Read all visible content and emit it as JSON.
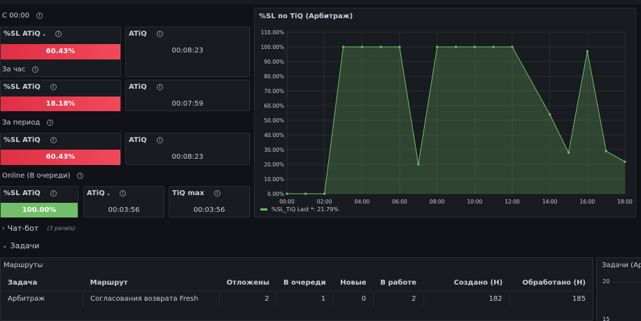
{
  "section_today": {
    "label": "С 00:00"
  },
  "section_hour": {
    "label": "За час"
  },
  "section_period": {
    "label": "За период"
  },
  "section_online": {
    "label": "Online (В очереди)"
  },
  "stats_today": {
    "sl_title": "%SL ATiQ .",
    "sl_value": "60.43%",
    "atiq_title": "ATiQ",
    "atiq_value": "00:08:23"
  },
  "stats_hour": {
    "sl_title": "%SL ATiQ",
    "sl_value": "18.18%",
    "atiq_title": "ATiQ",
    "atiq_value": "00:07:59"
  },
  "stats_period": {
    "sl_title": "%SL ATiQ",
    "sl_value": "60.43%",
    "atiq_title": "ATiQ",
    "atiq_value": "00:08:23"
  },
  "stats_online": {
    "sl_title": "%SL ATiQ",
    "sl_value": "100.00%",
    "atiq_title": "ATiQ .",
    "atiq_value": "00:03:56",
    "tiqmax_title": "TiQ max",
    "tiqmax_value": "00:03:56"
  },
  "chart_panel": {
    "title": "%SL по TiQ (Арбитраж)",
    "legend": "%SL_TiQ   Last *: 21.79%"
  },
  "chart_data": {
    "type": "area",
    "title": "%SL по TiQ (Арбитраж)",
    "series": [
      {
        "name": "%SL_TiQ",
        "values": [
          0,
          0,
          0,
          100,
          100,
          100,
          100,
          20,
          100,
          100,
          100,
          100,
          100,
          54,
          28,
          97,
          29,
          21.79
        ]
      }
    ],
    "x": [
      "00:00",
      "01:00",
      "02:00",
      "03:00",
      "04:00",
      "05:00",
      "06:00",
      "07:00",
      "08:00",
      "09:00",
      "10:00",
      "11:00",
      "12:00",
      "14:00",
      "15:00",
      "16:00",
      "17:00",
      "18:00"
    ],
    "x_tick_labels": [
      "00:00",
      "02:00",
      "04:00",
      "06:00",
      "08:00",
      "10:00",
      "12:00",
      "14:00",
      "16:00",
      "18:00"
    ],
    "y_tick_labels": [
      "0.00%",
      "10.00%",
      "20.00%",
      "30.00%",
      "40.00%",
      "50.00%",
      "60.00%",
      "70.00%",
      "80.00%",
      "90.00%",
      "100.00%",
      "110.00%"
    ],
    "ylim": [
      0,
      110
    ],
    "xlim_hours": [
      0,
      18
    ],
    "grid": true,
    "color": "#73bf69",
    "legend": "bottom-left"
  },
  "row_chatbot": {
    "title": "Чат-бот",
    "meta": "(3 panels)"
  },
  "row_tasks": {
    "title": "Задачи"
  },
  "routes_panel": {
    "title": "Маршруты",
    "columns": [
      "Задача",
      "Маршрут",
      "Отложены",
      "В очереди",
      "Новые",
      "В работе",
      "Создано (Н)",
      "Обработано (Н)"
    ],
    "rows": [
      [
        "Арбитраж",
        "Согласования возврата Fresh",
        "2",
        "1",
        "0",
        "2",
        "182",
        "185"
      ]
    ]
  },
  "right_panel": {
    "title": "Задачи (Арб",
    "y_ticks": [
      "20",
      "15"
    ]
  },
  "colors": {
    "red": "#f2495c",
    "green": "#73bf69",
    "panel_bg": "#181b1f",
    "page_bg": "#111217"
  }
}
